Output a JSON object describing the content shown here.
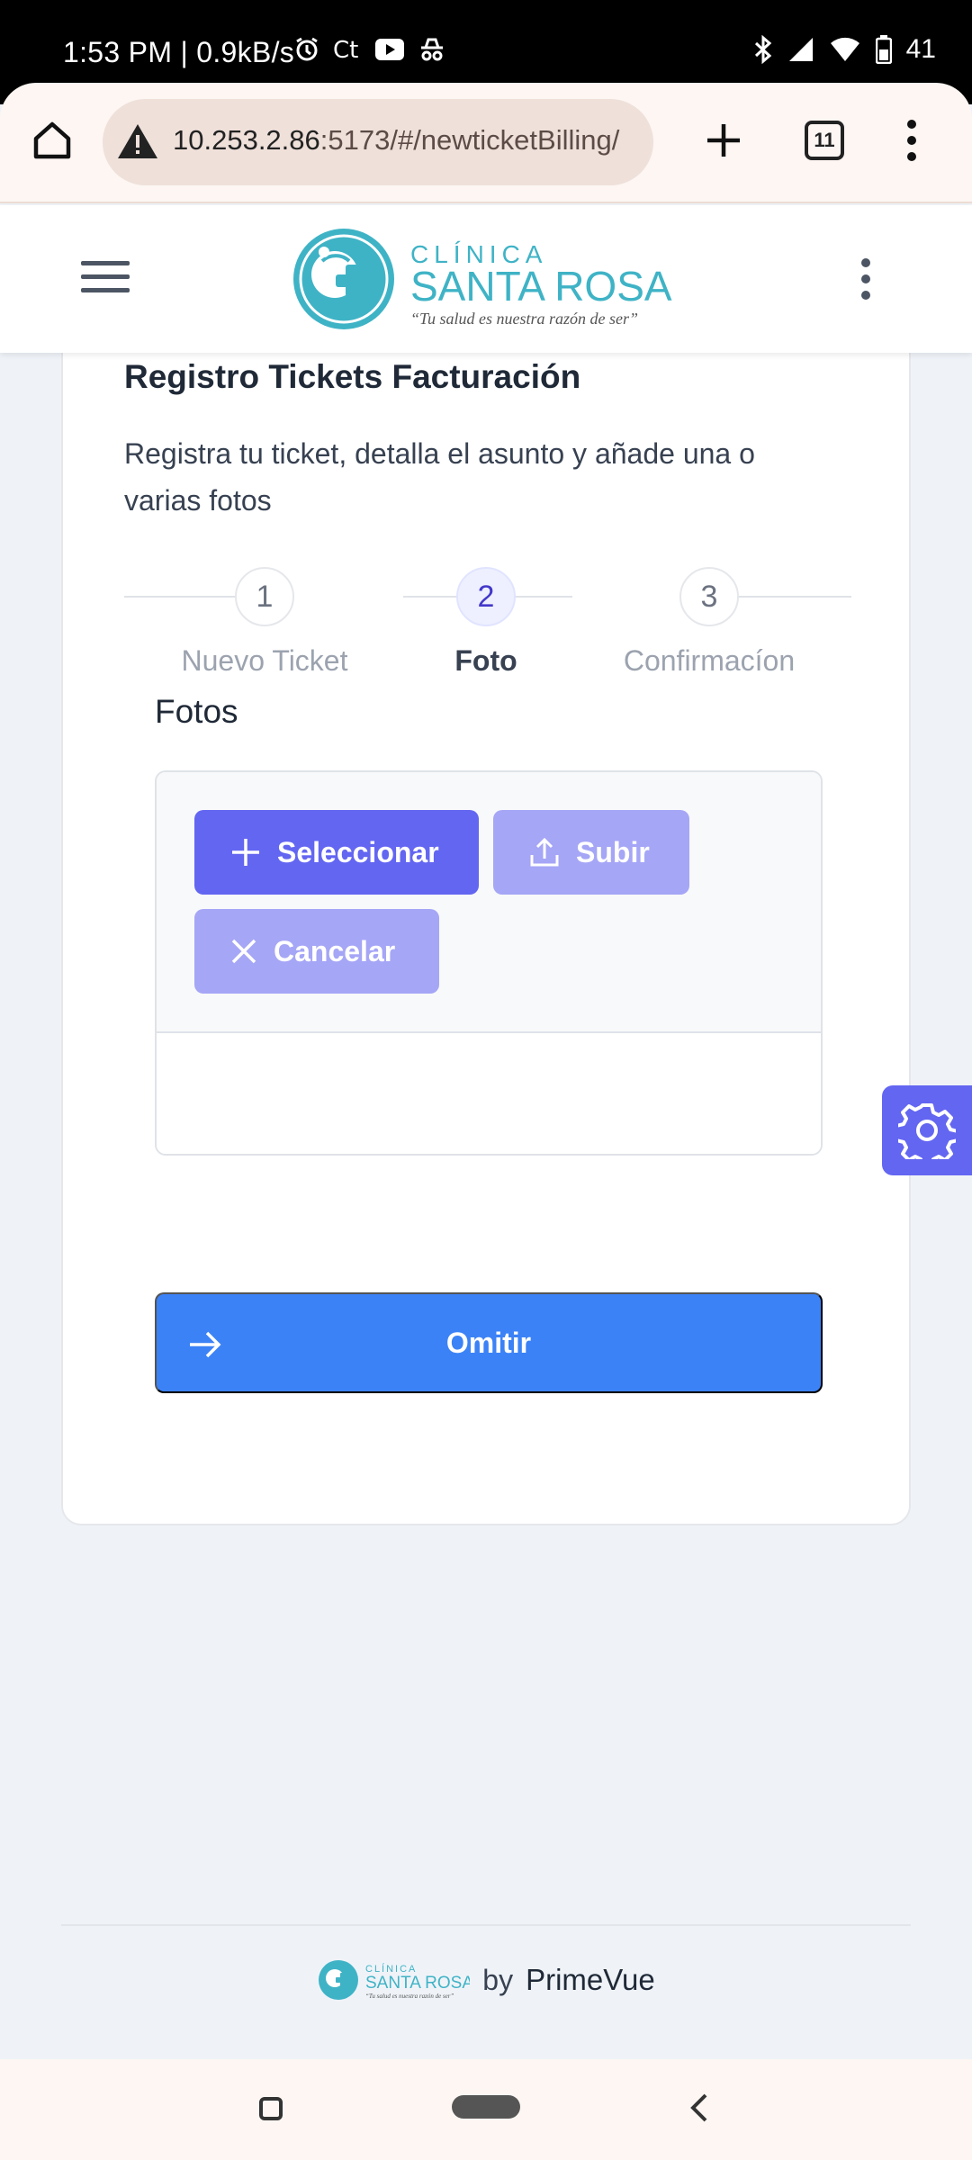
{
  "status_bar": {
    "time": "1:53 PM | 0.9kB/s",
    "battery": "41"
  },
  "browser": {
    "url_host": "10.253.2.86",
    "url_rest": ":5173/#/newticketBilling/",
    "tab_count": "11"
  },
  "header": {
    "logo_brand": "CLÍNICA",
    "logo_name": "SANTA ROSA",
    "logo_tagline": "“Tu salud es nuestra razón de ser”"
  },
  "card": {
    "title": "Registro Tickets Facturación",
    "description": "Registra tu ticket, detalla el asunto y añade una o varias fotos",
    "steps": [
      {
        "number": "1",
        "label": "Nuevo Ticket",
        "active": false
      },
      {
        "number": "2",
        "label": "Foto",
        "active": true
      },
      {
        "number": "3",
        "label": "Confirmacíon",
        "active": false
      }
    ],
    "section_title": "Fotos",
    "upload": {
      "select_label": "Seleccionar",
      "upload_label": "Subir",
      "cancel_label": "Cancelar"
    },
    "skip_label": "Omitir"
  },
  "footer": {
    "by": "by",
    "brand": "PrimeVue"
  },
  "colors": {
    "primary": "#6366f1",
    "primary_disabled": "#a5a6f6",
    "skip_button": "#3b82f6",
    "logo_teal": "#3fb3c6"
  }
}
